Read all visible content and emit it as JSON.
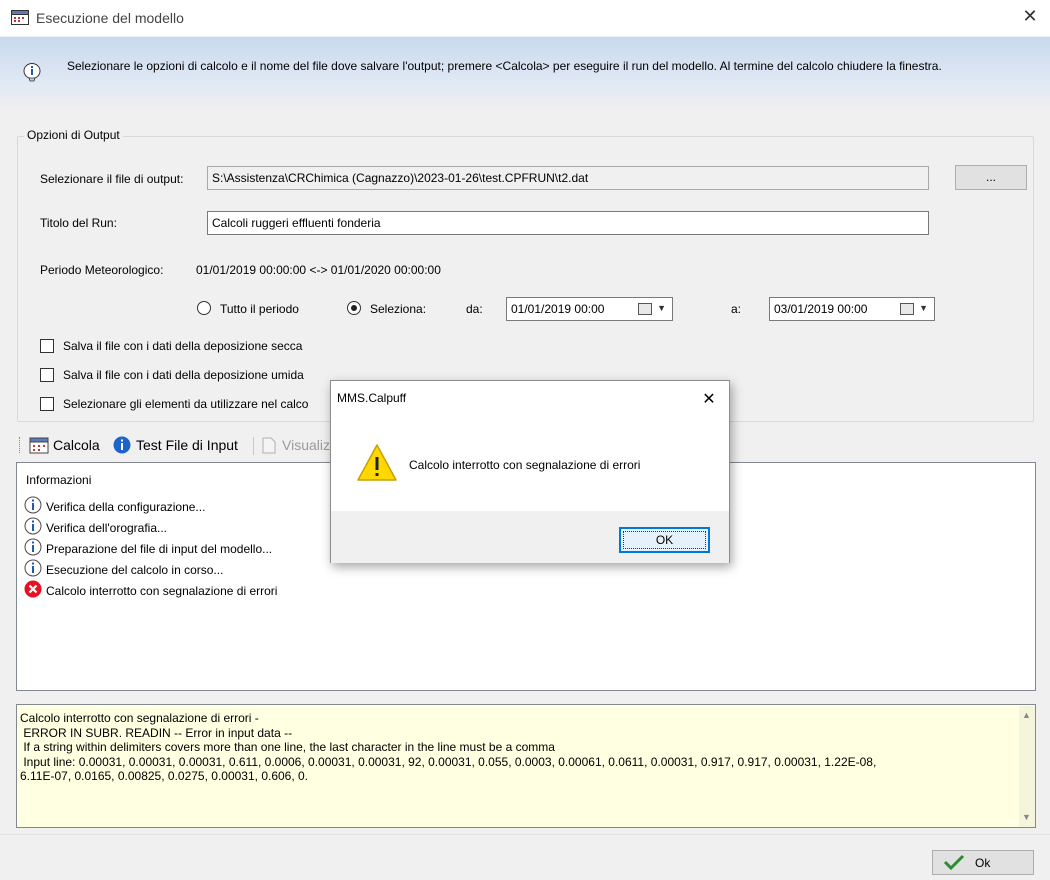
{
  "window": {
    "title": "Esecuzione del modello",
    "close_glyph": "✕"
  },
  "banner": {
    "text": "Selezionare le opzioni di calcolo e il nome del file dove salvare l'output; premere <Calcola> per eseguire il run del modello. Al termine del calcolo chiudere la finestra."
  },
  "output_options": {
    "legend": "Opzioni di Output",
    "file_label": "Selezionare il file di output:",
    "file_value": "S:\\Assistenza\\CRChimica (Cagnazzo)\\2023-01-26\\test.CPFRUN\\t2.dat",
    "browse_label": "...",
    "run_title_label": "Titolo del Run:",
    "run_title_value": "Calcoli ruggeri effluenti fonderia",
    "period_label": "Periodo Meteorologico:",
    "period_value": "01/01/2019 00:00:00 <-> 01/01/2020 00:00:00",
    "radio_all": "Tutto il periodo",
    "radio_select": "Seleziona:",
    "selected_radio": "select",
    "from_label": "da:",
    "from_value": "01/01/2019 00:00",
    "to_label": "a:",
    "to_value": "03/01/2019 00:00",
    "checkboxes": [
      {
        "label": "Salva il file con i dati della deposizione secca",
        "checked": false
      },
      {
        "label": "Salva il file con i dati della deposizione umida",
        "checked": false
      },
      {
        "label": "Selezionare gli elementi da utilizzare nel calco",
        "checked": false
      }
    ]
  },
  "toolbar": {
    "calcola": "Calcola",
    "test_file": "Test File di Input",
    "visualizza": "Visualiz"
  },
  "info": {
    "header": "Informazioni",
    "items": [
      {
        "text": "Verifica della configurazione...",
        "icon": "info-icon"
      },
      {
        "text": "Verifica dell'orografia...",
        "icon": "info-icon"
      },
      {
        "text": "Preparazione del file di input del modello...",
        "icon": "info-icon"
      },
      {
        "text": "Esecuzione del calcolo in corso...",
        "icon": "info-icon"
      },
      {
        "text": "Calcolo interrotto con segnalazione di errori",
        "icon": "error-icon"
      }
    ]
  },
  "error_log": {
    "text": "Calcolo interrotto con segnalazione di errori -\n ERROR IN SUBR. READIN -- Error in input data --\n If a string within delimiters covers more than one line, the last character in the line must be a comma\n Input line: 0.00031, 0.00031, 0.00031, 0.611, 0.0006, 0.00031, 0.00031, 92, 0.00031, 0.055, 0.0003, 0.00061, 0.0611, 0.00031, 0.917, 0.917, 0.00031, 1.22E-08,\n6.11E-07, 0.0165, 0.00825, 0.0275, 0.00031, 0.606, 0."
  },
  "bottom": {
    "ok_label": "Ok"
  },
  "modal": {
    "title": "MMS.Calpuff",
    "message": "Calcolo interrotto con segnalazione di errori",
    "ok_label": "OK",
    "close_glyph": "✕"
  },
  "colors": {
    "accent": "#0078d7",
    "banner_top": "#c9d9ee",
    "error_bg": "#ffffe1",
    "warning": "#ffd800",
    "error_red": "#e81123",
    "info_blue": "#1e5ab4"
  }
}
